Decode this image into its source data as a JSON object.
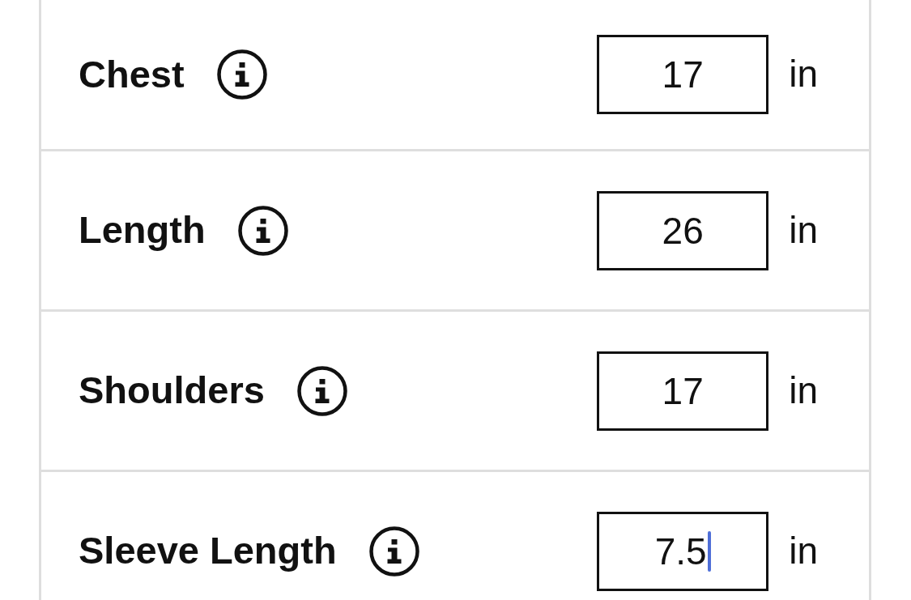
{
  "rows": [
    {
      "label": "Chest",
      "value": "17",
      "unit": "in",
      "focused": false
    },
    {
      "label": "Length",
      "value": "26",
      "unit": "in",
      "focused": false
    },
    {
      "label": "Shoulders",
      "value": "17",
      "unit": "in",
      "focused": false
    },
    {
      "label": "Sleeve Length",
      "value": "7.5",
      "unit": "in",
      "focused": true
    }
  ]
}
